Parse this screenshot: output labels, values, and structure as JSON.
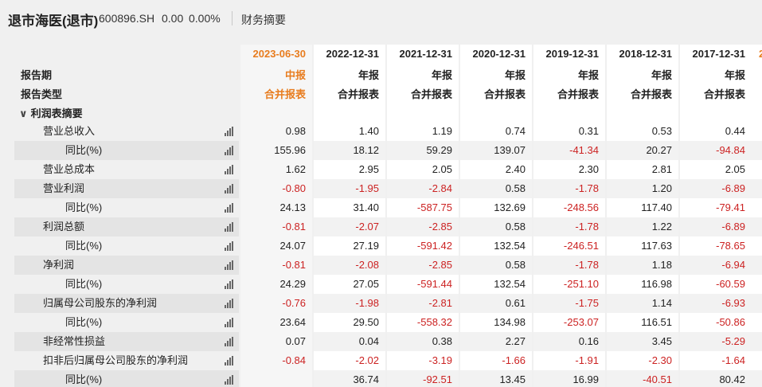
{
  "header": {
    "title": "退市海医(退市)",
    "code": "600896.SH",
    "price": "0.00",
    "change_pct": "0.00%",
    "section_tab": "财务摘要"
  },
  "table": {
    "header_labels": {
      "period": "报告期",
      "type": "报告类型"
    },
    "section": "利润表摘要",
    "columns": [
      {
        "date": "2023-06-30",
        "type": "中报",
        "report": "合并报表"
      },
      {
        "date": "2022-12-31",
        "type": "年报",
        "report": "合并报表"
      },
      {
        "date": "2021-12-31",
        "type": "年报",
        "report": "合并报表"
      },
      {
        "date": "2020-12-31",
        "type": "年报",
        "report": "合并报表"
      },
      {
        "date": "2019-12-31",
        "type": "年报",
        "report": "合并报表"
      },
      {
        "date": "2018-12-31",
        "type": "年报",
        "report": "合并报表"
      },
      {
        "date": "2017-12-31",
        "type": "年报",
        "report": "合并报表"
      }
    ],
    "partial_next_column": "2",
    "rows": [
      {
        "label": "营业总收入",
        "indent": 1,
        "values": [
          "0.98",
          "1.40",
          "1.19",
          "0.74",
          "0.31",
          "0.53",
          "0.44"
        ]
      },
      {
        "label": "同比(%)",
        "indent": 2,
        "values": [
          "155.96",
          "18.12",
          "59.29",
          "139.07",
          "-41.34",
          "20.27",
          "-94.84"
        ]
      },
      {
        "label": "营业总成本",
        "indent": 1,
        "values": [
          "1.62",
          "2.95",
          "2.05",
          "2.40",
          "2.30",
          "2.81",
          "2.05"
        ]
      },
      {
        "label": "营业利润",
        "indent": 1,
        "values": [
          "-0.80",
          "-1.95",
          "-2.84",
          "0.58",
          "-1.78",
          "1.20",
          "-6.89"
        ]
      },
      {
        "label": "同比(%)",
        "indent": 2,
        "values": [
          "24.13",
          "31.40",
          "-587.75",
          "132.69",
          "-248.56",
          "117.40",
          "-79.41"
        ]
      },
      {
        "label": "利润总额",
        "indent": 1,
        "values": [
          "-0.81",
          "-2.07",
          "-2.85",
          "0.58",
          "-1.78",
          "1.22",
          "-6.89"
        ]
      },
      {
        "label": "同比(%)",
        "indent": 2,
        "values": [
          "24.07",
          "27.19",
          "-591.42",
          "132.54",
          "-246.51",
          "117.63",
          "-78.65"
        ]
      },
      {
        "label": "净利润",
        "indent": 1,
        "values": [
          "-0.81",
          "-2.08",
          "-2.85",
          "0.58",
          "-1.78",
          "1.18",
          "-6.94"
        ]
      },
      {
        "label": "同比(%)",
        "indent": 2,
        "values": [
          "24.29",
          "27.05",
          "-591.44",
          "132.54",
          "-251.10",
          "116.98",
          "-60.59"
        ]
      },
      {
        "label": "归属母公司股东的净利润",
        "indent": 1,
        "values": [
          "-0.76",
          "-1.98",
          "-2.81",
          "0.61",
          "-1.75",
          "1.14",
          "-6.93"
        ]
      },
      {
        "label": "同比(%)",
        "indent": 2,
        "values": [
          "23.64",
          "29.50",
          "-558.32",
          "134.98",
          "-253.07",
          "116.51",
          "-50.86"
        ]
      },
      {
        "label": "非经常性损益",
        "indent": 1,
        "values": [
          "0.07",
          "0.04",
          "0.38",
          "2.27",
          "0.16",
          "3.45",
          "-5.29"
        ]
      },
      {
        "label": "扣非后归属母公司股东的净利润",
        "indent": 1,
        "values": [
          "-0.84",
          "-2.02",
          "-3.19",
          "-1.66",
          "-1.91",
          "-2.30",
          "-1.64"
        ]
      },
      {
        "label": "同比(%)",
        "indent": 2,
        "values": [
          "",
          "36.74",
          "-92.51",
          "13.45",
          "16.99",
          "-40.51",
          "80.42"
        ]
      }
    ]
  },
  "colors": {
    "accent": "#e87c1e",
    "negative": "#cc2222"
  },
  "icon": "bar-chart-icon"
}
